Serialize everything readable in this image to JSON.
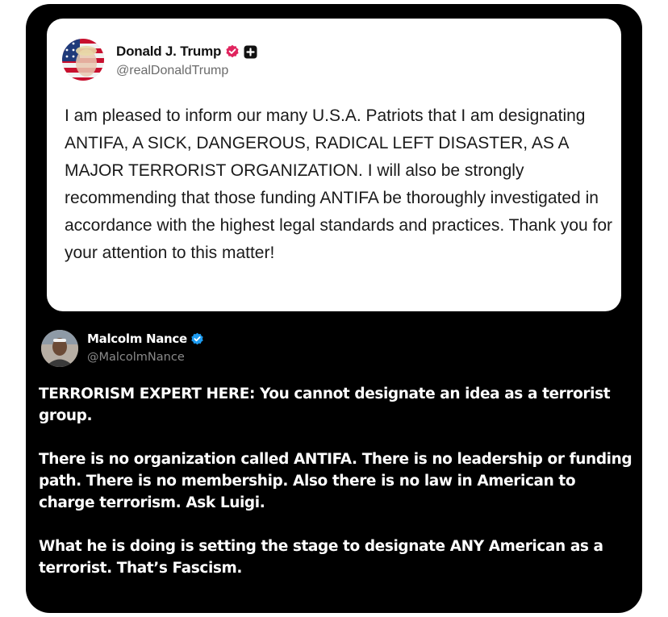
{
  "quoted_post": {
    "author_name": "Donald J. Trump",
    "author_handle": "@realDonaldTrump",
    "avatar_icon": "flag-portrait-avatar",
    "verified_icon": "verified-badge-icon",
    "plus_icon": "plus-square-icon",
    "verified_color": "#e0245e",
    "text": "I am pleased to inform our many U.S.A. Patriots that I am designating ANTIFA, A SICK, DANGEROUS, RADICAL LEFT DISASTER, AS A MAJOR TERRORIST ORGANIZATION. I will also be strongly recommending that those funding ANTIFA be thoroughly investigated in accordance with the highest legal standards and practices. Thank you for your attention to this matter!"
  },
  "reply_post": {
    "author_name": "Malcolm Nance",
    "author_handle": "@MalcolmNance",
    "avatar_icon": "person-photo-avatar",
    "verified_icon": "verified-badge-icon",
    "verified_color": "#1d9bf0",
    "paragraphs": [
      "TERRORISM EXPERT HERE: You cannot designate an idea as a terrorist group.",
      "There is no organization called ANTIFA.  There is no leadership or funding path. There is no membership.  Also there is no law in American to charge terrorism. Ask Luigi.",
      "What he is doing is setting the stage to designate ANY American as a terrorist. That’s Fascism."
    ]
  },
  "colors": {
    "background": "#000000",
    "card": "#ffffff"
  }
}
